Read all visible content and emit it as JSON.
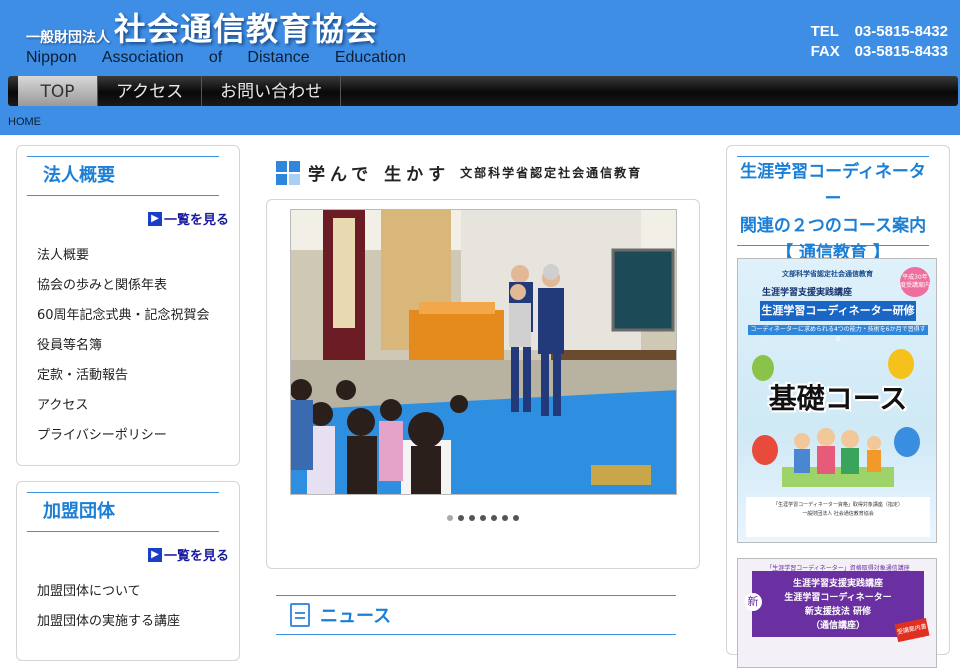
{
  "header": {
    "org_prefix": "一般財団法人",
    "org_name": "社会通信教育協会",
    "org_en": [
      "Nippon",
      "Association",
      "of",
      "Distance",
      "Education"
    ],
    "tel_label": "TEL",
    "tel": "03-5815-8432",
    "fax_label": "FAX",
    "fax": "03-5815-8433"
  },
  "nav": {
    "items": [
      {
        "label": "TOP"
      },
      {
        "label": "アクセス"
      },
      {
        "label": "お問い合わせ"
      }
    ]
  },
  "breadcrumb": "HOME",
  "sidebar": {
    "about": {
      "title": "法人概要",
      "more": "一覧を見る",
      "items": [
        {
          "label": "法人概要"
        },
        {
          "label": "協会の歩みと関係年表"
        },
        {
          "label": "60周年記念式典・記念祝賀会"
        },
        {
          "label": "役員等名簿"
        },
        {
          "label": "定款・活動報告"
        },
        {
          "label": "アクセス"
        },
        {
          "label": "プライバシーポリシー"
        }
      ]
    },
    "members": {
      "title": "加盟団体",
      "more": "一覧を見る",
      "items": [
        {
          "label": "加盟団体について"
        },
        {
          "label": "加盟団体の実施する講座"
        }
      ]
    }
  },
  "main": {
    "title_main": "学んで 生かす",
    "title_sub": "文部科学省認定社会通信教育",
    "slider": {
      "slide_count": 7,
      "active_index": 0
    },
    "news_title": "ニュース"
  },
  "right": {
    "heading_line1": "生涯学習コーディネーター",
    "heading_line2": "関連の２つのコース案内",
    "heading_line3": "【 通信教育 】",
    "poster1": {
      "tag": "文部科学省認定社会通信教育",
      "badge": "平成30年度受講案内",
      "line1": "生涯学習支援実践講座",
      "line2": "生涯学習コーディネーター研修",
      "line3": "コーディネーターに求められる4つの能力・技術を6か月で習得する",
      "course": "基礎コース",
      "footer1": "「生涯学習コーディネーター資格」取得対象講座（指定）",
      "footer2": "一般財団法人 社会通信教育協会"
    },
    "poster2": {
      "top": "「生涯学習コーディネーター」資格取得対象通信講座",
      "new": "新",
      "line1": "生涯学習支援実践講座",
      "line2": "生涯学習コーディネーター",
      "line3": "新支援技法 研修",
      "line4": "（通信講座）",
      "stamp": "受講案内書"
    }
  },
  "colors": {
    "header_bg": "#3f8ee6",
    "accent": "#1b7fd6",
    "nav_bg": "#111111"
  }
}
